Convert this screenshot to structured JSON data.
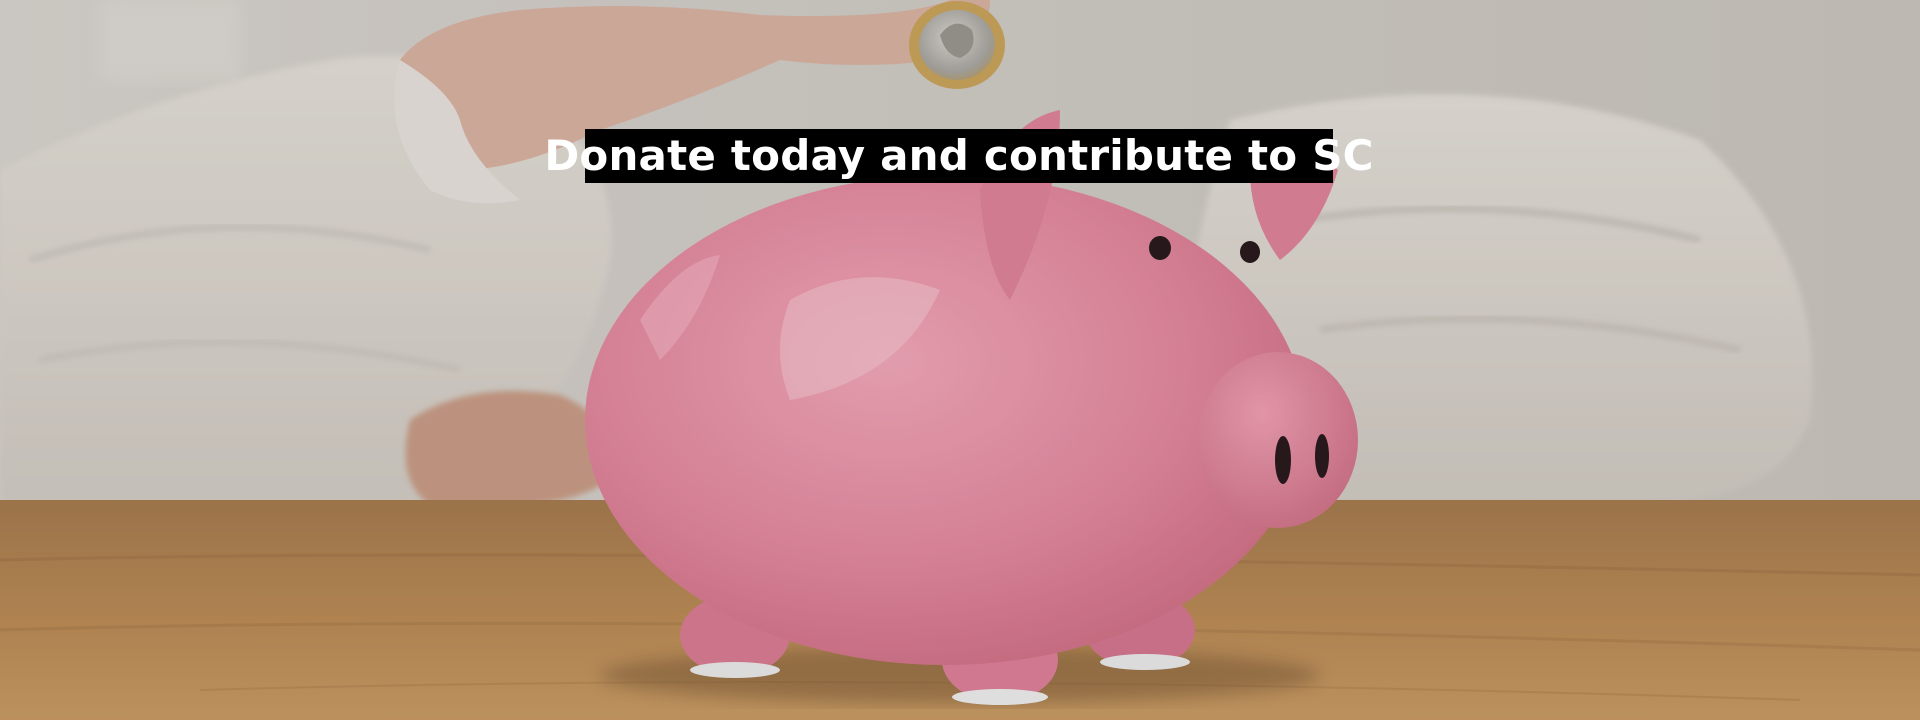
{
  "hero": {
    "caption": "Donate today and contribute to SC",
    "image_subject": "piggy-bank-coin",
    "colors": {
      "caption_bg": "#000000",
      "caption_text": "#ffffff",
      "pig_pink": "#e4889e",
      "table_wood": "#b98a55",
      "background": "#d2cdc7"
    }
  }
}
